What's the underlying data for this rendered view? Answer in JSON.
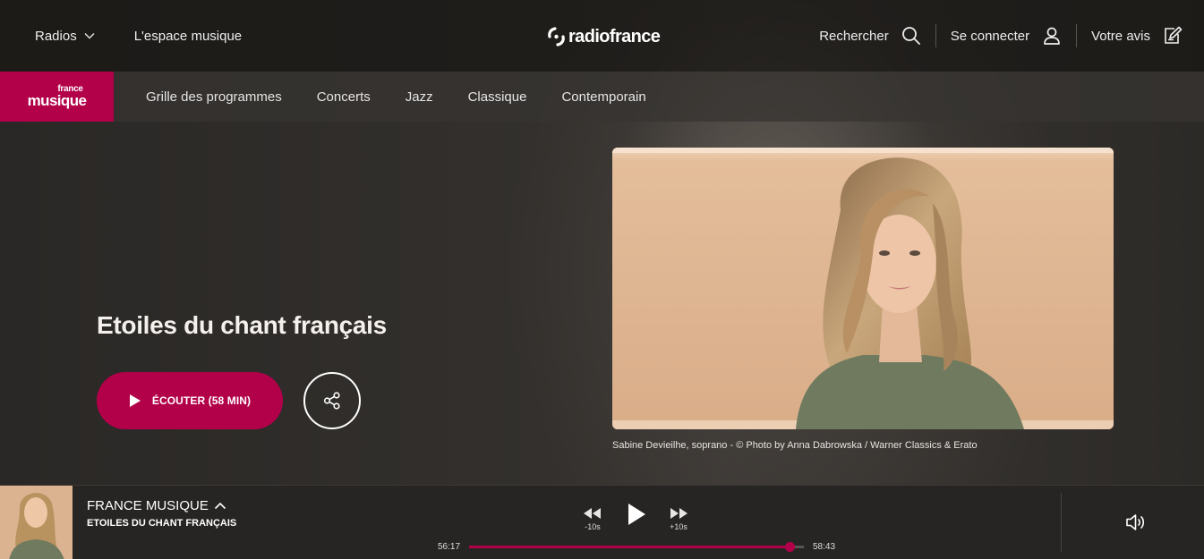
{
  "header": {
    "radios_label": "Radios",
    "espace_musique_label": "L'espace musique",
    "logo_text": "radiofrance",
    "search_label": "Rechercher",
    "login_label": "Se connecter",
    "feedback_label": "Votre avis"
  },
  "subnav": {
    "brand_small": "france",
    "brand_big": "musique",
    "items": [
      "Grille des programmes",
      "Concerts",
      "Jazz",
      "Classique",
      "Contemporain"
    ]
  },
  "hero": {
    "title": "Etoiles du chant français",
    "listen_label": "ÉCOUTER (58 MIN)",
    "caption": "Sabine Devieilhe, soprano - © Photo by Anna Dabrowska / Warner Classics & Erato"
  },
  "player": {
    "station": "FRANCE MUSIQUE",
    "show": "ETOILES DU CHANT FRANÇAIS",
    "rewind_label": "-10s",
    "forward_label": "+10s",
    "elapsed": "56:17",
    "duration": "58:43",
    "progress": 0.958
  },
  "colors": {
    "accent": "#b20049",
    "header_bg": "#181614",
    "player_bg": "#272523"
  }
}
